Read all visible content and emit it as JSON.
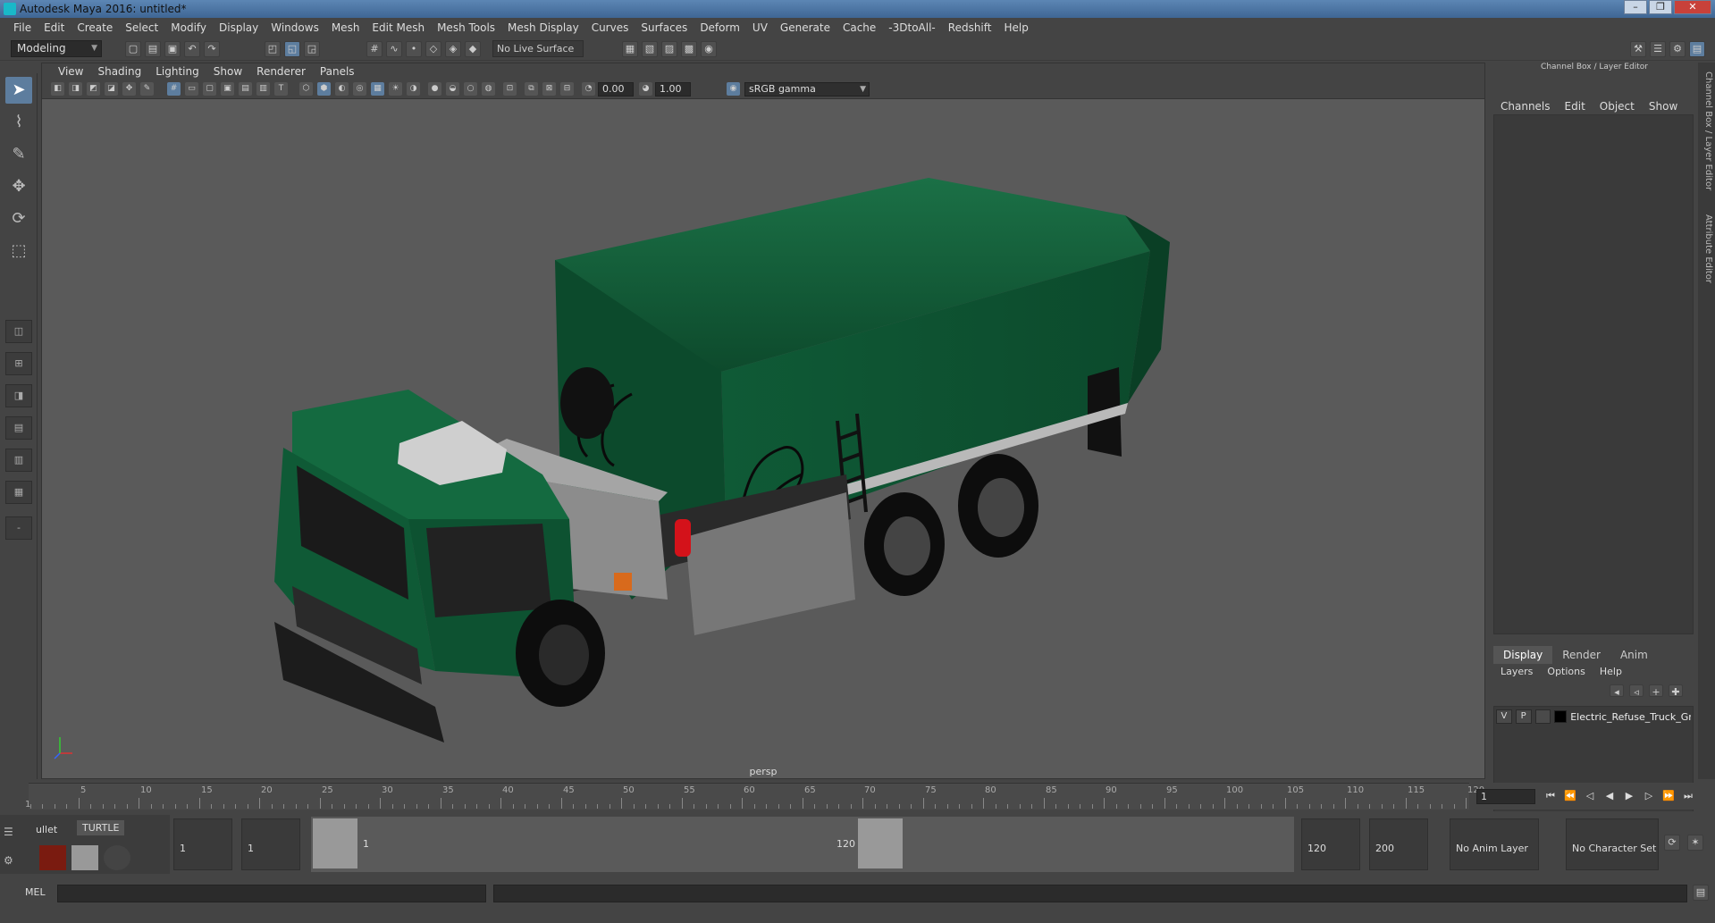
{
  "window": {
    "title": "Autodesk Maya 2016: untitled*",
    "controls": [
      "–",
      "❐",
      "✕"
    ]
  },
  "menubar": [
    "File",
    "Edit",
    "Create",
    "Select",
    "Modify",
    "Display",
    "Windows",
    "Mesh",
    "Edit Mesh",
    "Mesh Tools",
    "Mesh Display",
    "Curves",
    "Surfaces",
    "Deform",
    "UV",
    "Generate",
    "Cache",
    "-3DtoAll-",
    "Redshift",
    "Help"
  ],
  "toolbar": {
    "mode": "Modeling",
    "live_surface": "No Live Surface"
  },
  "viewport": {
    "menu": [
      "View",
      "Shading",
      "Lighting",
      "Show",
      "Renderer",
      "Panels"
    ],
    "exposure": "0.00",
    "gamma": "1.00",
    "color_space": "sRGB gamma",
    "camera_label": "persp"
  },
  "right_panel": {
    "header": "Channel Box / Layer Editor",
    "channel_menu": [
      "Channels",
      "Edit",
      "Object",
      "Show"
    ],
    "tabs": [
      "Display",
      "Render",
      "Anim"
    ],
    "active_tab": "Display",
    "layer_menu": [
      "Layers",
      "Options",
      "Help"
    ],
    "layers": [
      {
        "v": "V",
        "p": "P",
        "name": "Electric_Refuse_Truck_Gr"
      }
    ],
    "side_tabs": [
      "Channel Box / Layer Editor",
      "Attribute Editor"
    ]
  },
  "timeline": {
    "ticks": [
      "5",
      "10",
      "15",
      "20",
      "25",
      "30",
      "35",
      "40",
      "45",
      "50",
      "55",
      "60",
      "65",
      "70",
      "75",
      "80",
      "85",
      "90",
      "95",
      "100",
      "105",
      "110",
      "115",
      "120"
    ],
    "start_label": "1",
    "current_frame": "1"
  },
  "range": {
    "shelf_tabs": [
      "ullet",
      "TURTLE"
    ],
    "start": "1",
    "playback_start": "1",
    "slider_start": "1",
    "slider_end": "120",
    "playback_end": "120",
    "end": "200",
    "anim_layer": "No Anim Layer",
    "character_set": "No Character Set"
  },
  "command_line": {
    "label": "MEL"
  },
  "colors": {
    "truck": "#0f5a37",
    "accent": "#5d7d9e",
    "maya": "#15c4d4"
  }
}
